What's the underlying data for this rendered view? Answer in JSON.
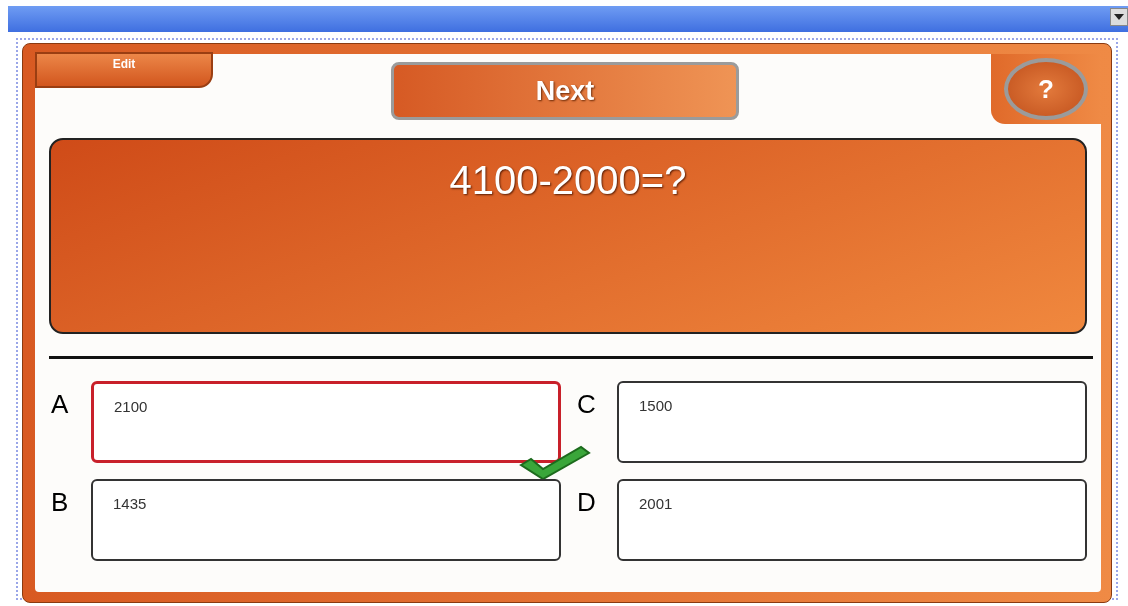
{
  "edit_button": "Edit",
  "next_button": "Next",
  "help_button": "?",
  "question": "4100-2000=?",
  "answers": [
    {
      "letter": "A",
      "text": "2100",
      "selected": true,
      "correct": true
    },
    {
      "letter": "B",
      "text": "1435",
      "selected": false,
      "correct": false
    },
    {
      "letter": "C",
      "text": "1500",
      "selected": false,
      "correct": false
    },
    {
      "letter": "D",
      "text": "2001",
      "selected": false,
      "correct": false
    }
  ]
}
